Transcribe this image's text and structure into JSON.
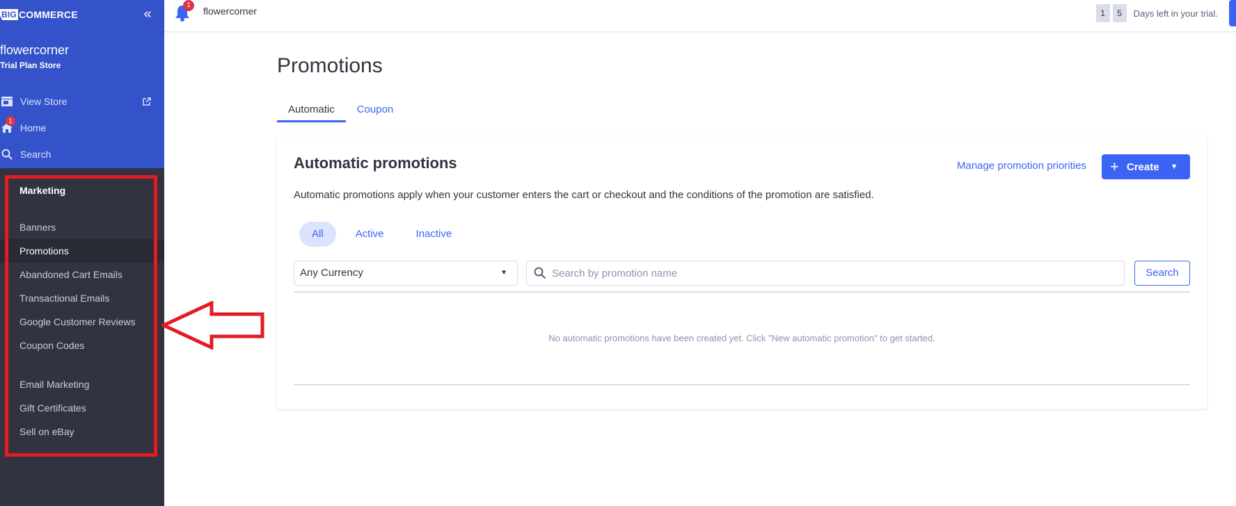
{
  "brand": {
    "logo_big": "BIG",
    "logo_rest": "COMMERCE"
  },
  "sidebar": {
    "store_name": "flowercorner",
    "store_plan": "Trial Plan Store",
    "top_items": [
      {
        "label": "View Store",
        "icon": "storefront-icon"
      },
      {
        "label": "Home",
        "icon": "home-icon",
        "badge": "1"
      },
      {
        "label": "Search",
        "icon": "search-icon"
      }
    ],
    "section_title": "Marketing",
    "menu": [
      {
        "label": "Banners"
      },
      {
        "label": "Promotions",
        "active": true
      },
      {
        "label": "Abandoned Cart Emails"
      },
      {
        "label": "Transactional Emails"
      },
      {
        "label": "Google Customer Reviews"
      },
      {
        "label": "Coupon Codes"
      },
      {
        "label": "Email Marketing"
      },
      {
        "label": "Gift Certificates"
      },
      {
        "label": "Sell on eBay"
      }
    ]
  },
  "topbar": {
    "notification_count": "1",
    "store_name": "flowercorner",
    "trial_digits": [
      "1",
      "5"
    ],
    "trial_text": "Days left in your trial."
  },
  "main": {
    "title": "Promotions",
    "tabs": [
      {
        "label": "Automatic",
        "active": true
      },
      {
        "label": "Coupon"
      }
    ],
    "card": {
      "title": "Automatic promotions",
      "manage_link": "Manage promotion priorities",
      "create_label": "Create",
      "description": "Automatic promotions apply when your customer enters the cart or checkout and the conditions of the promotion are satisfied.",
      "filters": [
        {
          "label": "All",
          "active": true
        },
        {
          "label": "Active"
        },
        {
          "label": "Inactive"
        }
      ],
      "currency_selected": "Any Currency",
      "search_placeholder": "Search by promotion name",
      "search_button": "Search",
      "empty_message": "No automatic promotions have been created yet. Click \"New automatic promotion\" to get started."
    }
  },
  "colors": {
    "accent": "#3c64f4",
    "sidebar_top": "#3452c9",
    "sidebar_bottom": "#313440",
    "highlight": "#e41b23"
  }
}
